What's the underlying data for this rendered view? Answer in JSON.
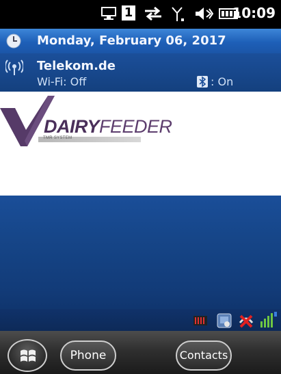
{
  "status_bar": {
    "time": "10:09",
    "badge_number": "1",
    "icons": [
      "connectivity-icon",
      "sync-icon",
      "signal-antenna-icon",
      "speaker-muted-icon",
      "battery-icon"
    ]
  },
  "today": {
    "date": "Monday, February 06, 2017",
    "carrier": "Telekom.de",
    "wifi_status": "Wi-Fi: Off",
    "bluetooth_status": ": On"
  },
  "logo": {
    "word1": "DAIRY",
    "word2": "FEEDER",
    "subtitle": "TMR SYSTEM"
  },
  "tray": {
    "icons": [
      "keyboard-icon",
      "app-icon",
      "no-connection-icon",
      "signal-bars-icon"
    ]
  },
  "softkeys": {
    "left": "Phone",
    "right": "Contacts"
  },
  "colors": {
    "today_row": "#1e5fb8",
    "wallpaper": "#164689",
    "logo_purple": "#4a2f5a"
  }
}
